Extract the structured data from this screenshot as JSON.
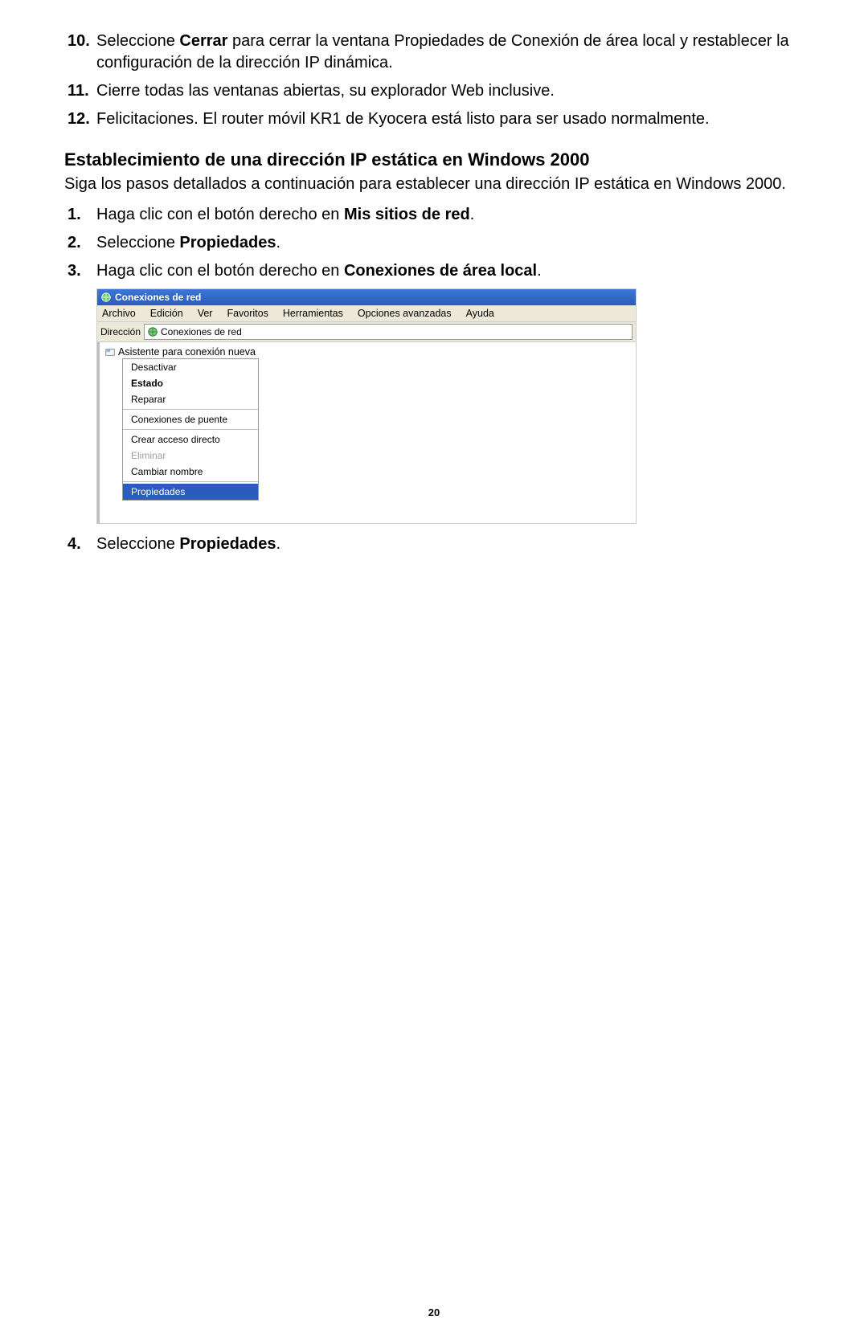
{
  "steps_continued": [
    {
      "num": "10.",
      "before": "Seleccione ",
      "bold": "Cerrar",
      "after": " para cerrar la ventana Propiedades de Conexión de área local y restablecer la configuración de la dirección IP dinámica."
    },
    {
      "num": "11.",
      "before": "Cierre todas las ventanas abiertas, su explorador Web inclusive.",
      "bold": "",
      "after": ""
    },
    {
      "num": "12.",
      "before": "Felicitaciones. El router móvil KR1 de Kyocera está listo para ser usado normalmente.",
      "bold": "",
      "after": ""
    }
  ],
  "section_title": "Establecimiento de una dirección IP estática en Windows 2000",
  "section_desc": "Siga los pasos detallados a continuación para establecer una dirección IP estática en Windows 2000.",
  "steps": [
    {
      "num": "1.",
      "before": "Haga clic con el botón derecho en ",
      "bold": "Mis sitios de red",
      "after": "."
    },
    {
      "num": "2.",
      "before": "Seleccione ",
      "bold": "Propiedades",
      "after": "."
    },
    {
      "num": "3.",
      "before": "Haga clic con el botón derecho en ",
      "bold": "Conexiones de área local",
      "after": "."
    }
  ],
  "step4": {
    "num": "4.",
    "before": "Seleccione ",
    "bold": "Propiedades",
    "after": "."
  },
  "window": {
    "title": "Conexiones de red",
    "menu": [
      "Archivo",
      "Edición",
      "Ver",
      "Favoritos",
      "Herramientas",
      "Opciones avanzadas",
      "Ayuda"
    ],
    "address_label": "Dirección",
    "address_value": "Conexiones de red",
    "item1": "Asistente para conexión nueva",
    "context": {
      "desactivar": "Desactivar",
      "estado": "Estado",
      "reparar": "Reparar",
      "puente": "Conexiones de puente",
      "acceso": "Crear acceso directo",
      "eliminar": "Eliminar",
      "cambiar": "Cambiar nombre",
      "propiedades": "Propiedades"
    }
  },
  "page_number": "20"
}
